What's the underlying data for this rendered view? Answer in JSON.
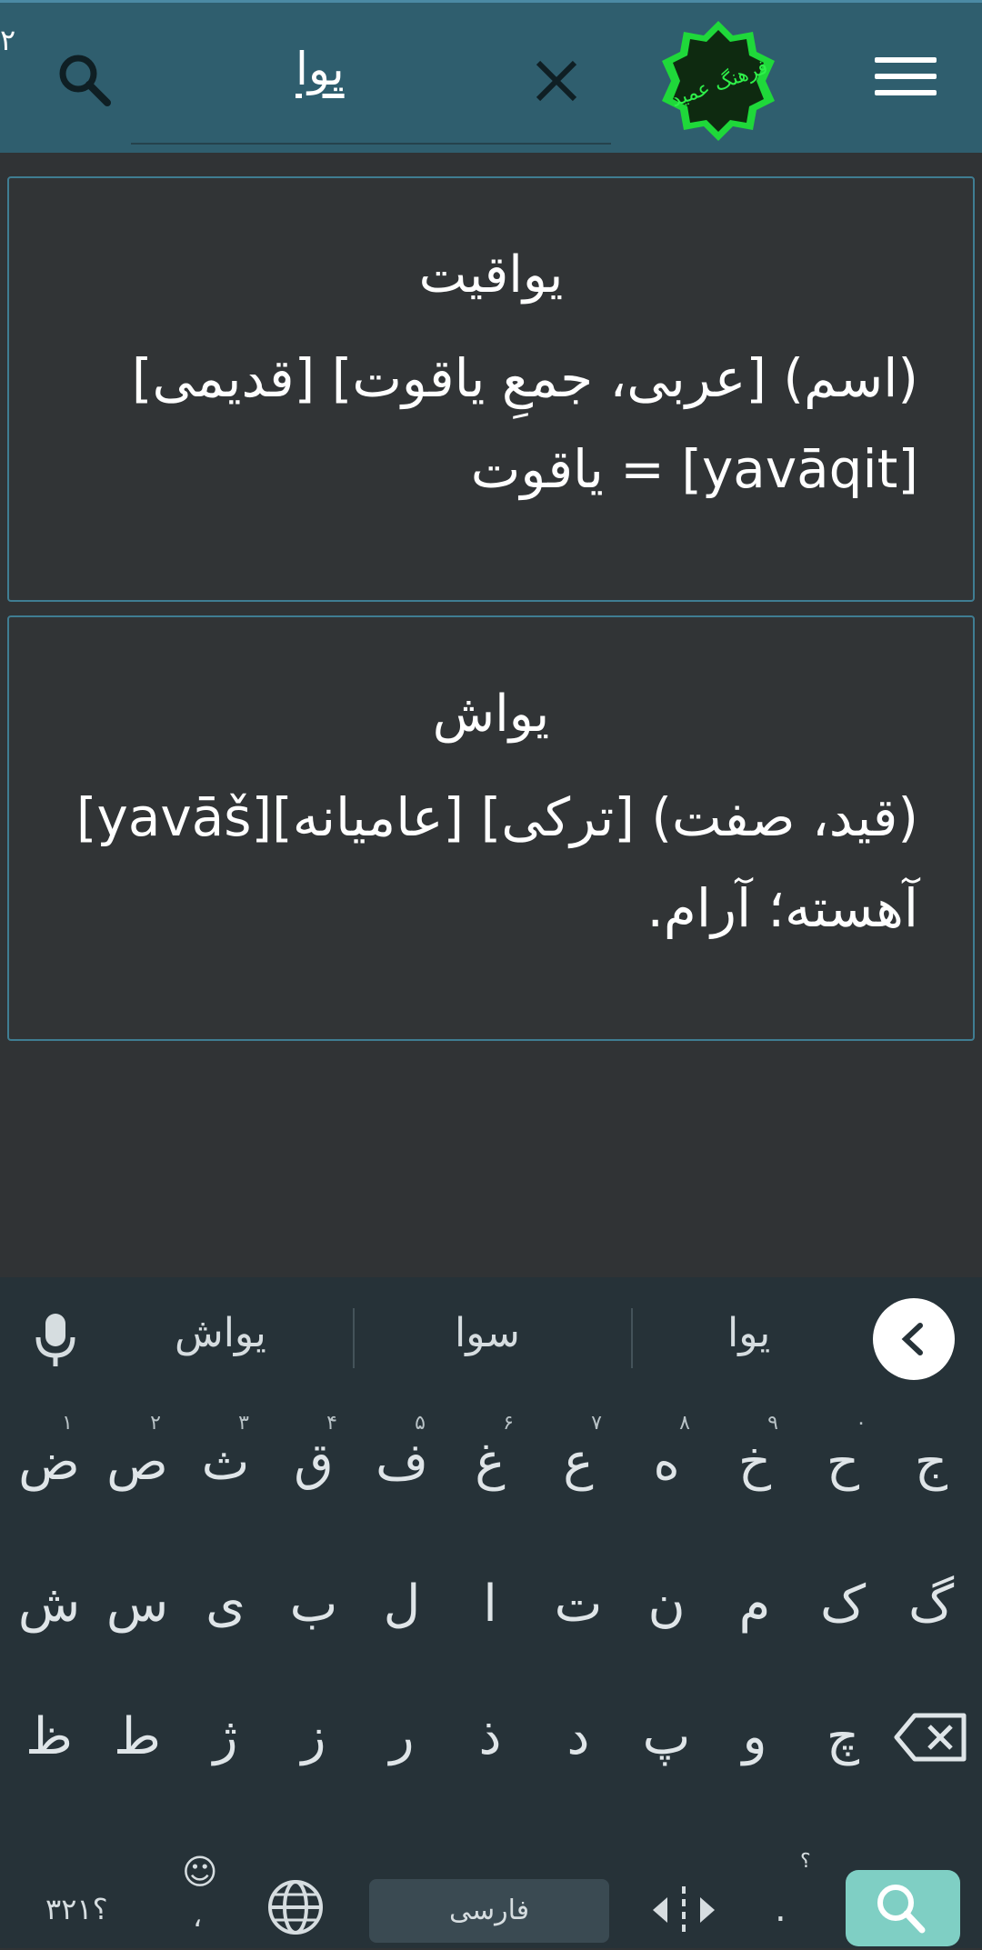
{
  "header": {
    "corner_number": "۲",
    "query": "یوا",
    "logo_text": "فرهنگ عمید",
    "colors": {
      "bar": "#2f5e6e",
      "logo_green": "#1fd83a"
    }
  },
  "results": [
    {
      "title": "یواقیت",
      "line1": "(اسم) [عربی، جمعِ یاقوت] [قدیمی]",
      "line2": "[yavāqit] = یاقوت"
    },
    {
      "title": "یواش",
      "line1": "(قید، صفت) [ترکی] [عامیانه][yavāš]",
      "line2": "آهسته؛ آرام."
    }
  ],
  "keyboard": {
    "suggestions": [
      "یواش",
      "سوا",
      "یوا"
    ],
    "row1": [
      {
        "k": "ض",
        "d": "۱"
      },
      {
        "k": "ص",
        "d": "۲"
      },
      {
        "k": "ث",
        "d": "۳"
      },
      {
        "k": "ق",
        "d": "۴"
      },
      {
        "k": "ف",
        "d": "۵"
      },
      {
        "k": "غ",
        "d": "۶"
      },
      {
        "k": "ع",
        "d": "۷"
      },
      {
        "k": "ه",
        "d": "۸"
      },
      {
        "k": "خ",
        "d": "۹"
      },
      {
        "k": "ح",
        "d": "۰"
      },
      {
        "k": "ج",
        "d": ""
      }
    ],
    "row2": [
      "ش",
      "س",
      "ی",
      "ب",
      "ل",
      "ا",
      "ت",
      "ن",
      "م",
      "ک",
      "گ"
    ],
    "row3": [
      "ظ",
      "ط",
      "ژ",
      "ز",
      "ر",
      "ذ",
      "د",
      "پ",
      "و",
      "چ"
    ],
    "symbols_label": "؟۳۲۱",
    "emoji_label": "☺",
    "comma_label": "،",
    "space_label": "فارسی",
    "period_label": ".",
    "period_hint": "؟"
  }
}
